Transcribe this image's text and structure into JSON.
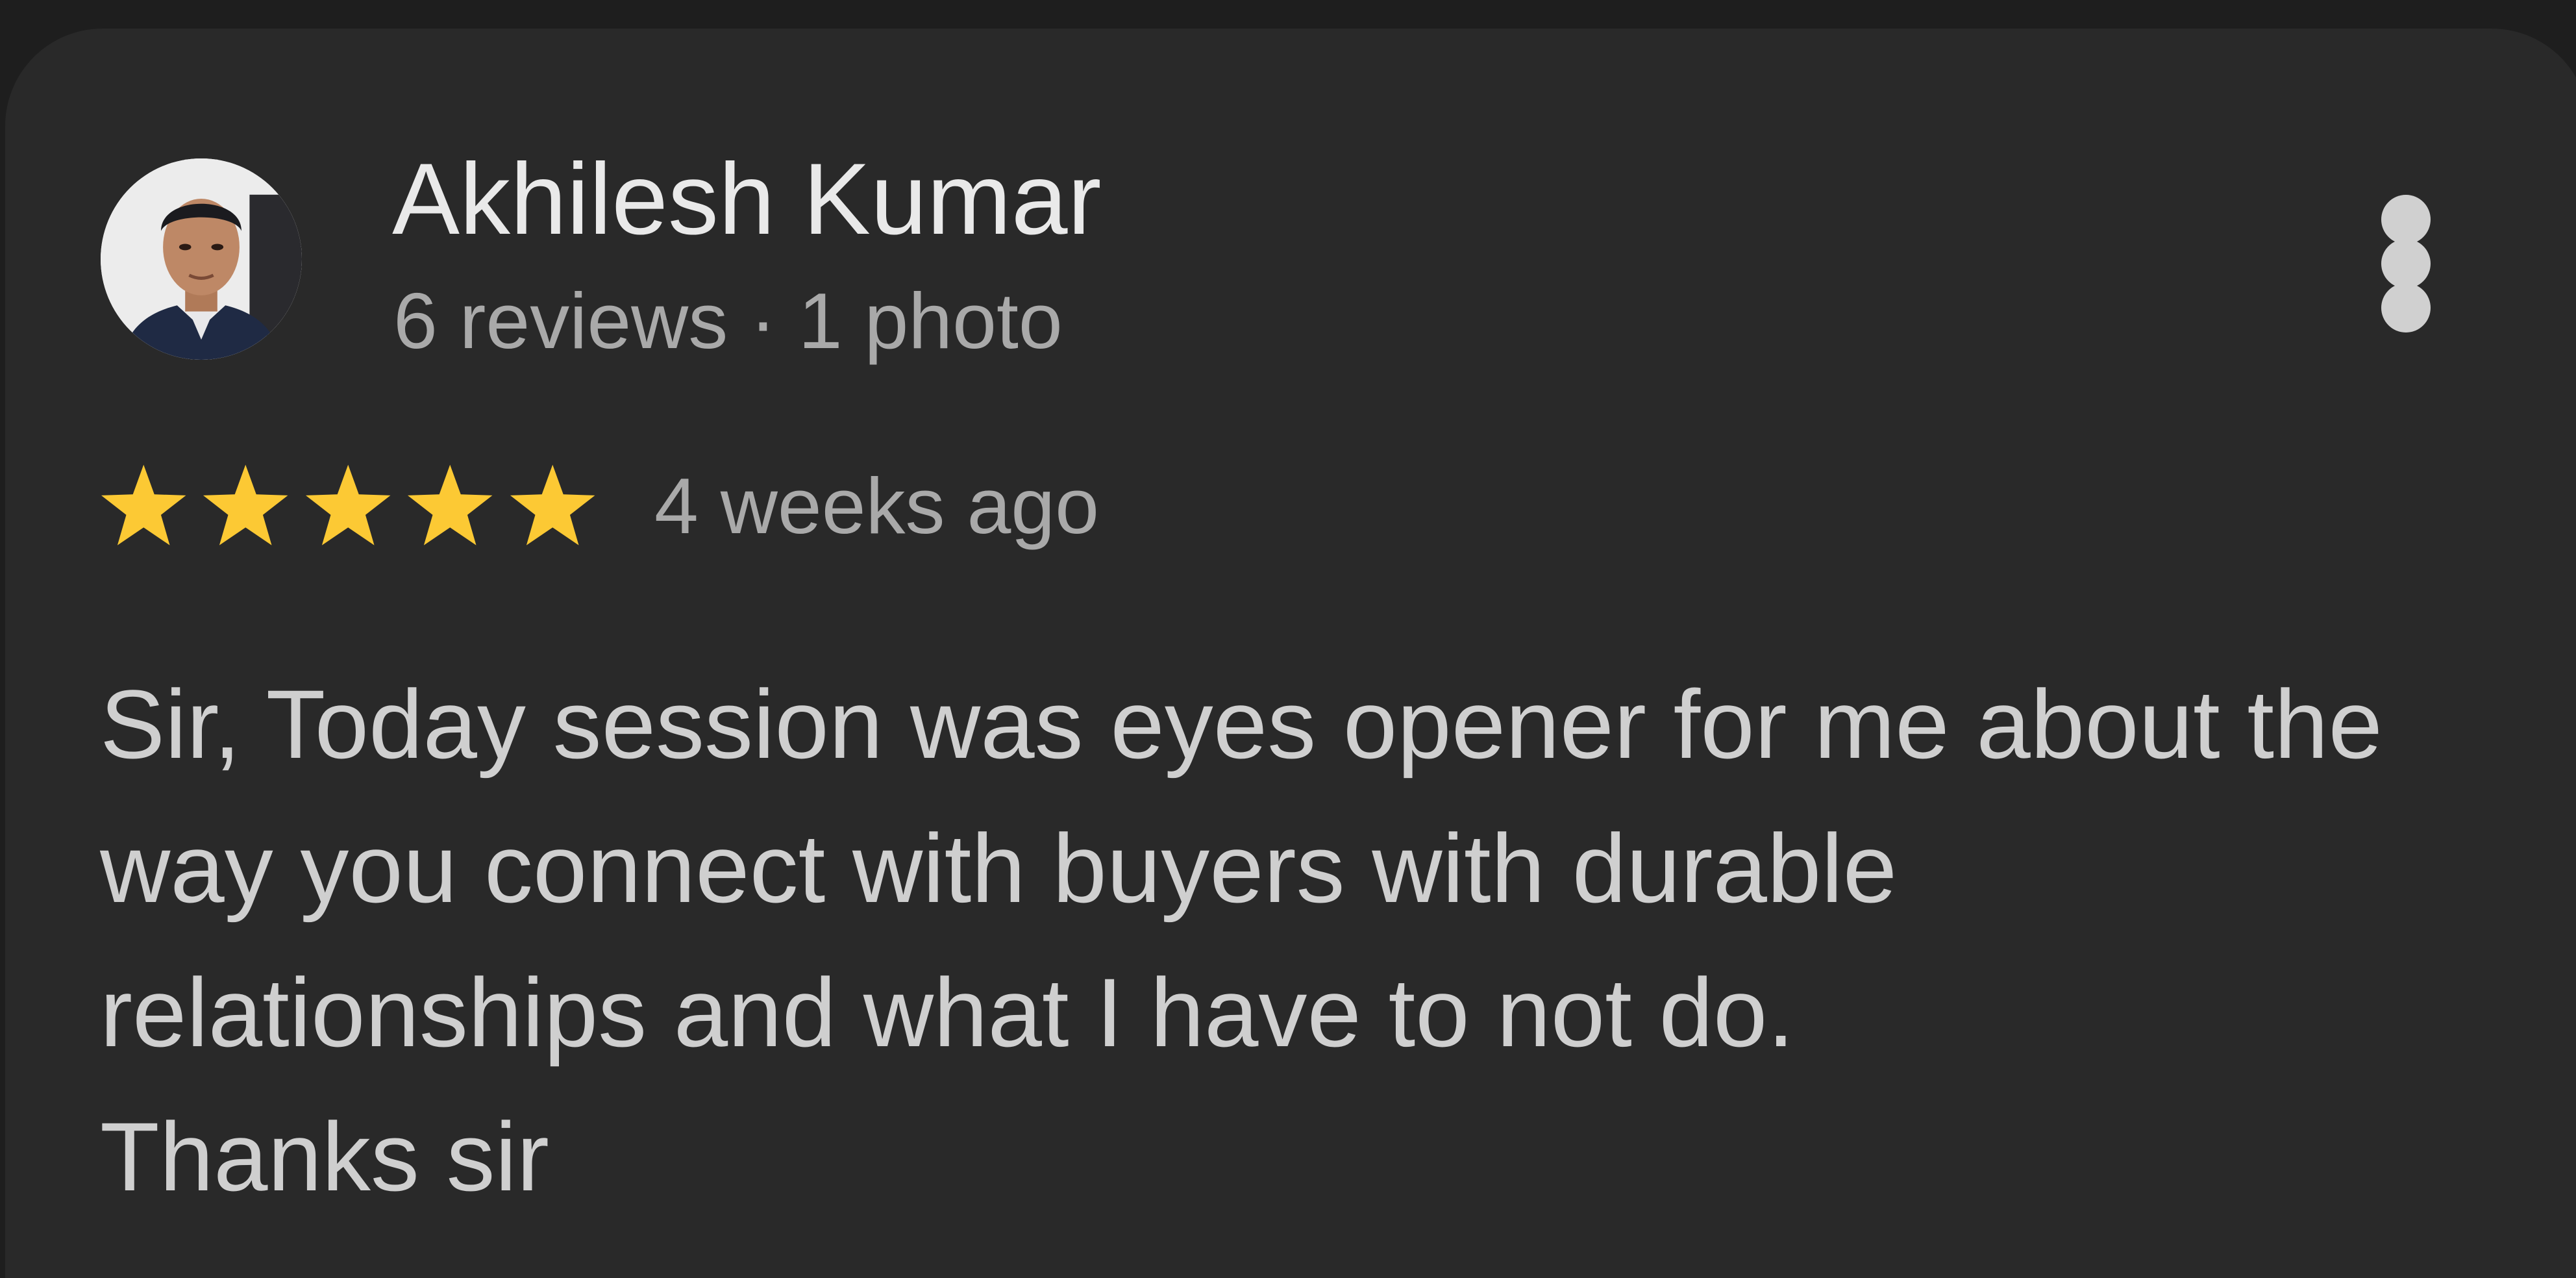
{
  "review": {
    "author_name": "Akhilesh Kumar",
    "author_meta": "6 reviews · 1 photo",
    "rating": 5,
    "rating_max": 5,
    "time": "4 weeks ago",
    "text_lines": [
      "Sir, Today session was eyes opener for me about the",
      "way you connect with buyers with durable",
      "relationships and what I have to not do.",
      "Thanks sir"
    ]
  },
  "icons": {
    "avatar": "user-avatar-photo",
    "more": "more-vert-icon",
    "star": "star-icon"
  },
  "colors": {
    "card_bg": "#292929",
    "page_bg": "#1e1e1e",
    "star": "#fcc934",
    "name_text": "#e9e9e9",
    "secondary_text": "#a9a9a9",
    "body_text": "#cfcfcf"
  }
}
